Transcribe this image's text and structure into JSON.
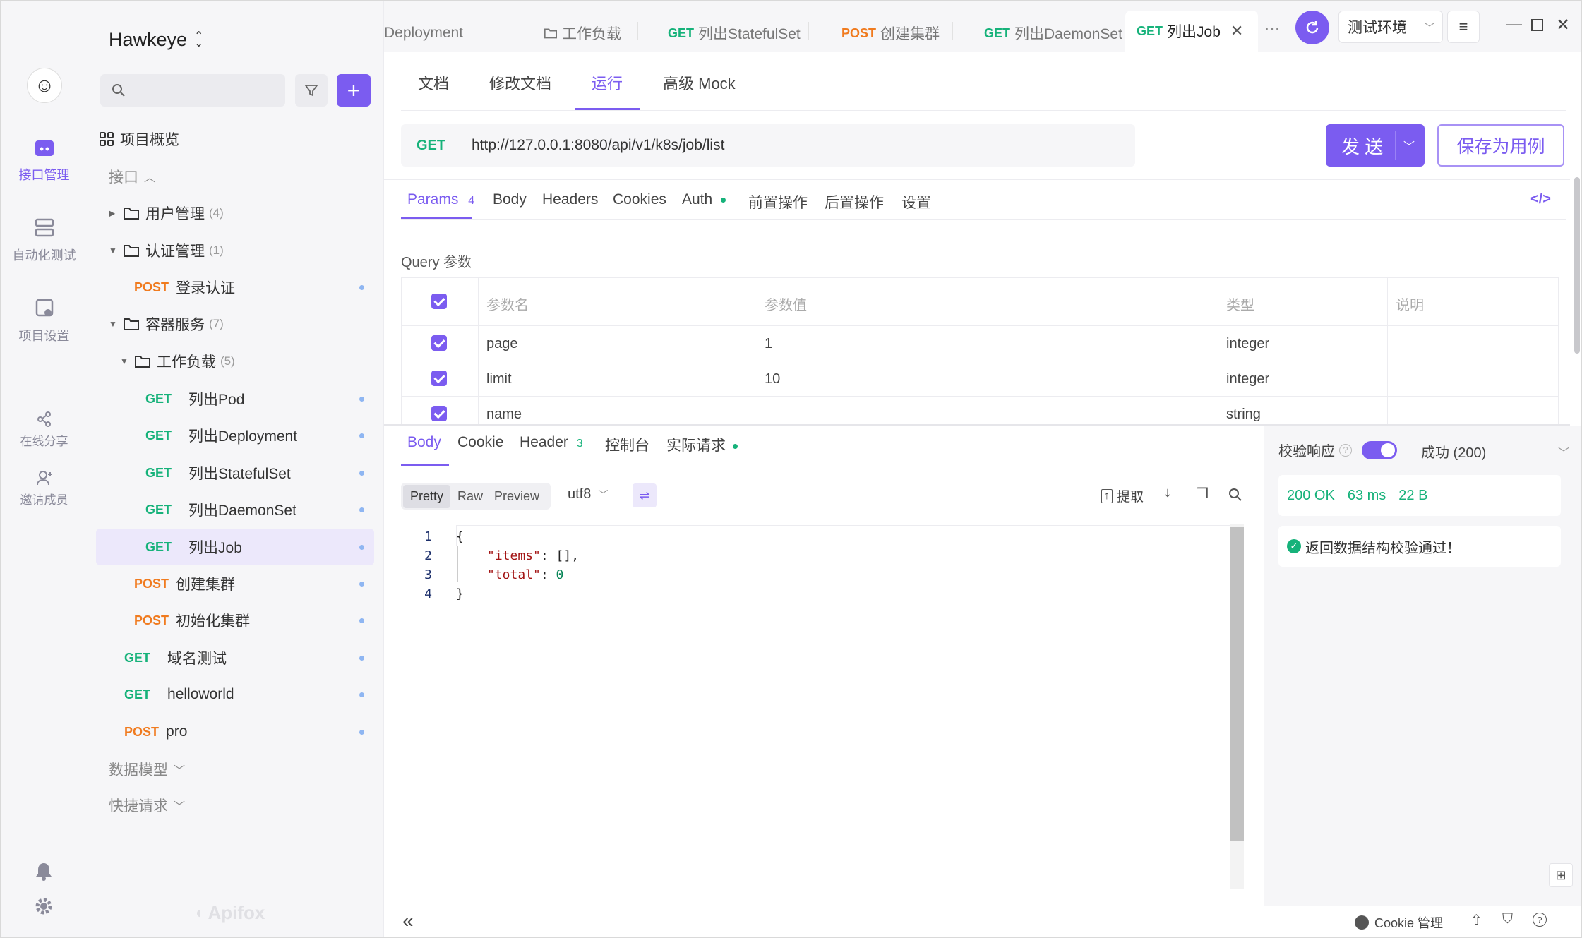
{
  "app": {
    "project_name": "Hawkeye",
    "watermark": "Apifox"
  },
  "rail": {
    "items": [
      {
        "label": "接口管理",
        "icon": "api-icon"
      },
      {
        "label": "自动化测试",
        "icon": "autotest-icon"
      },
      {
        "label": "项目设置",
        "icon": "settings-doc-icon"
      },
      {
        "label": "在线分享",
        "icon": "share-icon"
      },
      {
        "label": "邀请成员",
        "icon": "invite-icon"
      }
    ]
  },
  "sidebar": {
    "search_placeholder": "",
    "overview": "项目概览",
    "section_api": "接口",
    "section_models": "数据模型",
    "section_quick": "快捷请求",
    "tree": [
      {
        "type": "folder",
        "label": "用户管理",
        "count": "(4)",
        "expanded": false
      },
      {
        "type": "folder",
        "label": "认证管理",
        "count": "(1)",
        "expanded": true
      },
      {
        "type": "api",
        "method": "POST",
        "label": "登录认证"
      },
      {
        "type": "folder",
        "label": "容器服务",
        "count": "(7)",
        "expanded": true
      },
      {
        "type": "folder",
        "label": "工作负载",
        "count": "(5)",
        "expanded": true
      },
      {
        "type": "api",
        "method": "GET",
        "label": "列出Pod"
      },
      {
        "type": "api",
        "method": "GET",
        "label": "列出Deployment"
      },
      {
        "type": "api",
        "method": "GET",
        "label": "列出StatefulSet"
      },
      {
        "type": "api",
        "method": "GET",
        "label": "列出DaemonSet"
      },
      {
        "type": "api",
        "method": "GET",
        "label": "列出Job",
        "selected": true
      },
      {
        "type": "api",
        "method": "POST",
        "label": "创建集群"
      },
      {
        "type": "api",
        "method": "POST",
        "label": "初始化集群"
      },
      {
        "type": "api",
        "method": "GET",
        "label": "域名测试"
      },
      {
        "type": "api",
        "method": "GET",
        "label": "helloworld"
      },
      {
        "type": "api",
        "method": "POST",
        "label": "pro"
      }
    ]
  },
  "tabs": [
    {
      "method": "",
      "label": "Deployment"
    },
    {
      "method": "",
      "label": "工作负载",
      "folder": true
    },
    {
      "method": "GET",
      "label": "列出StatefulSet"
    },
    {
      "method": "POST",
      "label": "创建集群"
    },
    {
      "method": "GET",
      "label": "列出DaemonSet"
    },
    {
      "method": "GET",
      "label": "列出Job",
      "active": true
    }
  ],
  "env": {
    "selected": "测试环境"
  },
  "subtabs": [
    "文档",
    "修改文档",
    "运行",
    "高级 Mock"
  ],
  "request": {
    "method": "GET",
    "url": "http://127.0.0.1:8080/api/v1/k8s/job/list",
    "send_label": "发 送",
    "save_label": "保存为用例"
  },
  "param_tabs": [
    {
      "label": "Params",
      "badge": "4"
    },
    {
      "label": "Body"
    },
    {
      "label": "Headers"
    },
    {
      "label": "Cookies"
    },
    {
      "label": "Auth"
    },
    {
      "label": "前置操作"
    },
    {
      "label": "后置操作"
    },
    {
      "label": "设置"
    }
  ],
  "query": {
    "title": "Query 参数",
    "headers": [
      "参数名",
      "参数值",
      "类型",
      "说明"
    ],
    "rows": [
      {
        "name": "page",
        "value": "1",
        "type": "integer",
        "desc": ""
      },
      {
        "name": "limit",
        "value": "10",
        "type": "integer",
        "desc": ""
      },
      {
        "name": "name",
        "value": "",
        "type": "string",
        "desc": ""
      }
    ]
  },
  "response_tabs": [
    {
      "label": "Body"
    },
    {
      "label": "Cookie"
    },
    {
      "label": "Header",
      "badge": "3"
    },
    {
      "label": "控制台"
    },
    {
      "label": "实际请求"
    }
  ],
  "view_modes": [
    "Pretty",
    "Raw",
    "Preview"
  ],
  "encoding": "utf8",
  "tools": {
    "extract": "提取"
  },
  "code_lines": [
    {
      "n": "1",
      "text": "{"
    },
    {
      "n": "2",
      "key": "\"items\"",
      "rest": ": [],"
    },
    {
      "n": "3",
      "key": "\"total\"",
      "rest": ": ",
      "num": "0"
    },
    {
      "n": "4",
      "text": "}"
    }
  ],
  "validation": {
    "label": "校验响应",
    "status_select": "成功 (200)",
    "status": "200 OK",
    "time": "63 ms",
    "size": "22 B",
    "message": "返回数据结构校验通过！"
  },
  "footer": {
    "cookie_label": "Cookie 管理"
  },
  "colors": {
    "accent": "#7b5cf0",
    "get": "#16b27a",
    "post": "#f07b1f"
  }
}
